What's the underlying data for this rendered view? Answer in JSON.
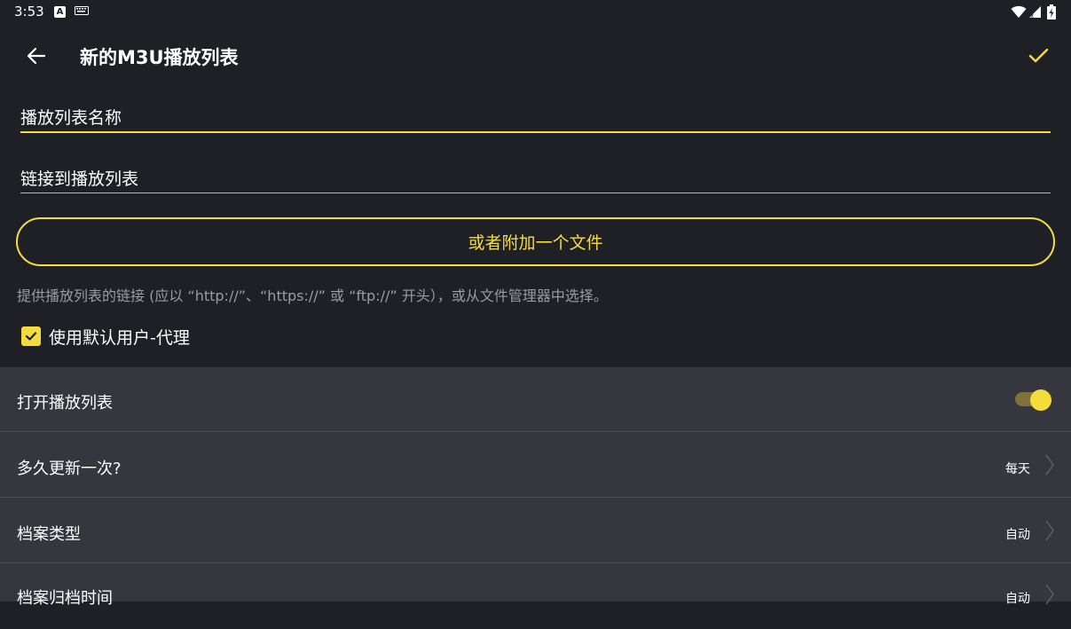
{
  "status_bar": {
    "time": "3:53",
    "app_icon_letter": "A",
    "icons": [
      "app-notification-icon",
      "keyboard-icon",
      "wifi-icon",
      "signal-icon",
      "battery-charging-icon"
    ]
  },
  "toolbar": {
    "title": "新的M3U播放列表",
    "back_icon": "arrow-left-icon",
    "confirm_icon": "check-icon"
  },
  "form": {
    "name_field_value": "播放列表名称",
    "url_field_value": "链接到播放列表",
    "attach_button_label": "或者附加一个文件",
    "help_text": "提供播放列表的链接 (应以 “http://”、“https://” 或 “ftp://” 开头），或从文件管理器中选择。",
    "checkbox_label": "使用默认用户-代理",
    "checkbox_checked": true
  },
  "settings": {
    "open_playlist_label": "打开播放列表",
    "open_playlist_enabled": true,
    "update_frequency_label": "多久更新一次?",
    "update_frequency_value": "每天",
    "file_type_label": "档案类型",
    "file_type_value": "自动",
    "archive_time_label": "档案归档时间",
    "archive_time_value": "自动"
  },
  "colors": {
    "accent": "#f4dd3b",
    "background": "#1f2026",
    "list_background": "#35363e",
    "muted_text": "#9a9ba3"
  }
}
